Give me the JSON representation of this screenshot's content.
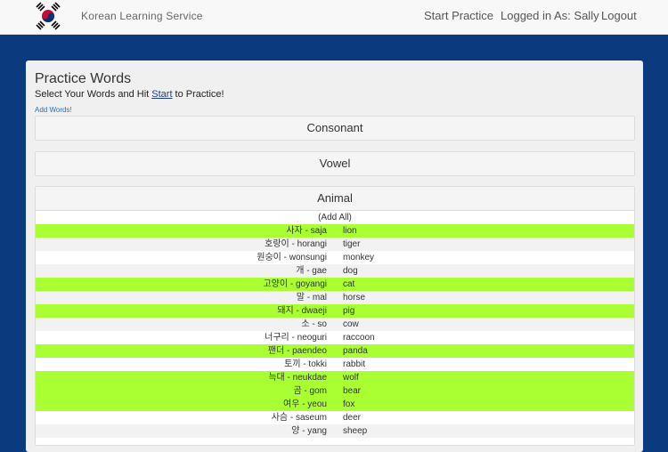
{
  "header": {
    "brand": "Korean Learning Service",
    "nav": {
      "start_practice": "Start Practice",
      "logged_in": "Logged in As: Sally",
      "logout": "Logout"
    }
  },
  "main": {
    "title": "Practice Words",
    "subtitle_before": "Select Your Words and Hit ",
    "subtitle_link": "Start",
    "subtitle_after": " to Practice!",
    "add_words": "Add Words!",
    "categories": {
      "consonant": "Consonant",
      "vowel": "Vowel",
      "animal": "Animal"
    },
    "add_all": "(Add All)",
    "words": [
      {
        "kor": "사자 - saja",
        "eng": "lion",
        "selected": true
      },
      {
        "kor": "호랑이 - horangi",
        "eng": "tiger",
        "selected": false
      },
      {
        "kor": "원숭이 - wonsungi",
        "eng": "monkey",
        "selected": false
      },
      {
        "kor": "개 - gae",
        "eng": "dog",
        "selected": false
      },
      {
        "kor": "고양이 - goyangi",
        "eng": "cat",
        "selected": true
      },
      {
        "kor": "말 - mal",
        "eng": "horse",
        "selected": false
      },
      {
        "kor": "돼지 - dwaeji",
        "eng": "pig",
        "selected": true
      },
      {
        "kor": "소 - so",
        "eng": "cow",
        "selected": false
      },
      {
        "kor": "너구리 - neoguri",
        "eng": "raccoon",
        "selected": false
      },
      {
        "kor": "팬더 - paendeo",
        "eng": "panda",
        "selected": true
      },
      {
        "kor": "토끼 - tokki",
        "eng": "rabbit",
        "selected": false
      },
      {
        "kor": "늑대 - neukdae",
        "eng": "wolf",
        "selected": true
      },
      {
        "kor": "곰 - gom",
        "eng": "bear",
        "selected": true
      },
      {
        "kor": "여우 - yeou",
        "eng": "fox",
        "selected": true
      },
      {
        "kor": "사슴 - saseum",
        "eng": "deer",
        "selected": false
      },
      {
        "kor": "양 - yang",
        "eng": "sheep",
        "selected": false
      }
    ]
  },
  "colors": {
    "page_background": "#0b3a7e",
    "selected_row": "#aaff33",
    "link": "#1a3d8f"
  }
}
